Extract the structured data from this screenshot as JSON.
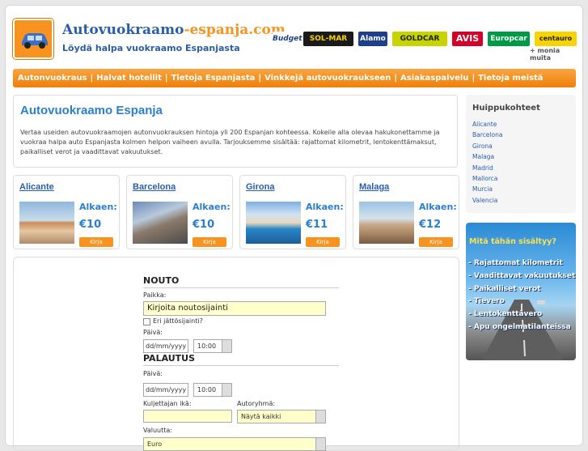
{
  "header": {
    "site_name_a": "Autovuokraamo",
    "site_name_b": "-espanja.com",
    "slogan": "Löydä halpa vuokraamo Espanjasta",
    "brands": [
      "Budget",
      "SOL-MAR",
      "Alamo",
      "GOLDCAR",
      "AVIS",
      "Europcar",
      "centauro"
    ],
    "more": "+ monia muita"
  },
  "nav": {
    "items": [
      "Autonvuokraus",
      "Halvat hotellit",
      "Tietoja Espanjasta",
      "Vinkkejä autovuokraukseen",
      "Asiakaspalvelu",
      "Tietoja meistä"
    ],
    "separator": "|"
  },
  "intro": {
    "title": "Autovuokraamo Espanja",
    "text": "Vertaa useiden autovuokraamojen autonvuokrauksen hintoja yli 200 Espanjan kohteessa. Kokeile alla olevaa hakukonettamme ja vuokraa halpa auto Espanjasta kolmen helpon vaiheen avulla. Tarjouksemme sisältää: rajattomat kilometrit, lentokenttämaksut, paikalliset verot ja vaadittavat vakuutukset."
  },
  "sidebar": {
    "title": "Huippukohteet",
    "items": [
      "Alicante",
      "Barcelona",
      "Girona",
      "Malaga",
      "Madrid",
      "Mallorca",
      "Murcia",
      "Valencia"
    ]
  },
  "cities": [
    {
      "name": "Alicante",
      "from": "Alkaen:",
      "price": "€10",
      "button": "Kirja"
    },
    {
      "name": "Barcelona",
      "from": "Alkaen:",
      "price": "€10",
      "button": "Kirja"
    },
    {
      "name": "Girona",
      "from": "Alkaen:",
      "price": "€11",
      "button": "Kirja"
    },
    {
      "name": "Malaga",
      "from": "Alkaen:",
      "price": "€12",
      "button": "Kirja"
    }
  ],
  "form": {
    "pickup_title": "NOUTO",
    "place_label": "Paikka:",
    "place_value": "Kirjoita noutosijainti",
    "diff_return": "Eri jättösijainti?",
    "date_label": "Päivä:",
    "date_value": "dd/mm/yyyy",
    "time_value": "10:00",
    "return_title": "PALAUTUS",
    "return_date_label": "Päivä:",
    "return_date_value": "dd/mm/yyyy",
    "return_time_value": "10:00",
    "age_label": "Kuljettajan ikä:",
    "group_label": "Autoryhmä:",
    "group_value": "Näytä kaikki",
    "currency_label": "Valuutta:",
    "currency_value": "Euro"
  },
  "promo": {
    "title": "Mitä tähän sisältyy?",
    "items": [
      "- Rajattomat kilometrit",
      "- Vaadittavat vakuutukset",
      "- Paikalliset verot",
      "- Tievero",
      "- Lentokenttävero",
      "- Apu ongelmatilanteissa"
    ]
  }
}
